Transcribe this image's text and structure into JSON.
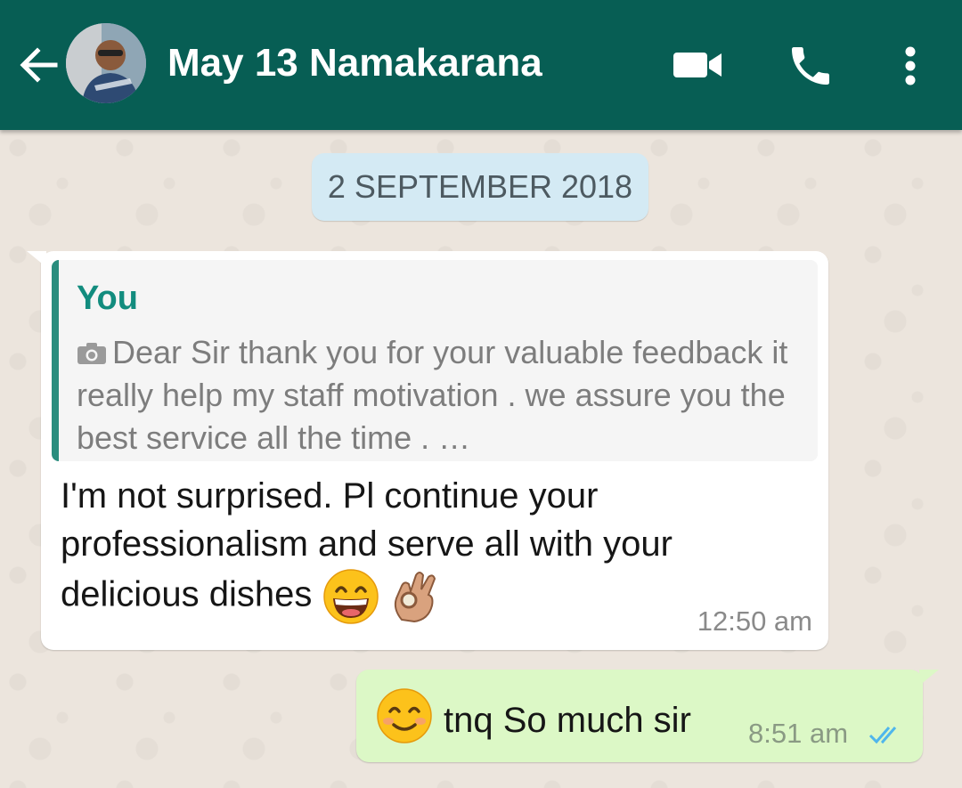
{
  "header": {
    "back_icon": "arrow-left-icon",
    "title": "May 13 Namakarana",
    "video_icon": "video-call-icon",
    "call_icon": "phone-icon",
    "more_icon": "more-vert-icon"
  },
  "chat": {
    "date_label": "2 SEPTEMBER 2018",
    "messages": [
      {
        "direction": "incoming",
        "quote": {
          "author": "You",
          "icon": "camera-icon",
          "text": "Dear Sir thank you for your valuable feedback it really help my staff motivation . we assure you the best service all the time . …"
        },
        "text": "I'm not surprised. Pl continue your professionalism and serve all with your delicious dishes",
        "emojis": [
          "grinning-face-emoji",
          "ok-hand-emoji"
        ],
        "time": "12:50 am"
      },
      {
        "direction": "outgoing",
        "emoji": "smiling-face-emoji",
        "text": "tnq So much sir",
        "time": "8:51 am",
        "status": "read",
        "status_icon": "double-check-icon"
      }
    ]
  },
  "colors": {
    "header_bg": "#075e54",
    "chat_bg": "#ece5dd",
    "incoming_bg": "#ffffff",
    "outgoing_bg": "#dcf8c6",
    "date_chip_bg": "#d4eaf4",
    "quote_bar": "#2a8d7e",
    "read_ticks": "#4fb6ec"
  }
}
